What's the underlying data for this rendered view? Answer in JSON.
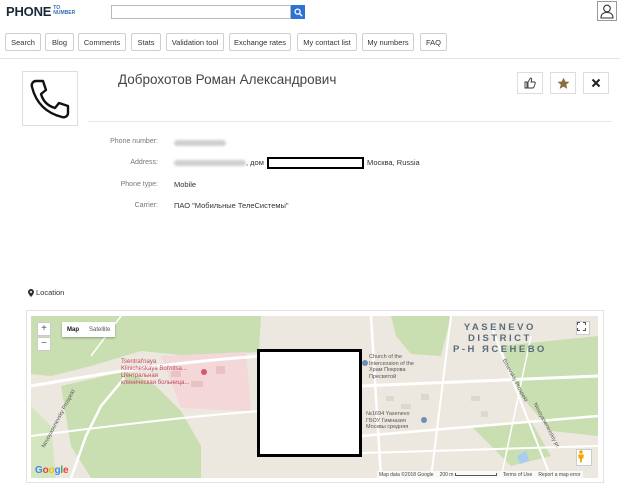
{
  "header": {
    "logo_main": "PHONE",
    "logo_to": "TO",
    "logo_number": "NUMBER",
    "search": {
      "value": "",
      "placeholder": ""
    },
    "icons": {
      "search": "search-icon",
      "user": "user-icon"
    }
  },
  "nav": {
    "items": [
      "Search",
      "Blog",
      "Comments",
      "Stats",
      "Validation tool",
      "Exchange rates",
      "My contact list",
      "My numbers",
      "FAQ"
    ]
  },
  "profile": {
    "name": "Доброхотов Роман Александрович",
    "avatar_icon": "phone-icon",
    "actions": {
      "like_icon": "thumbs-up-icon",
      "favorite_icon": "star-icon",
      "remove_icon": "close-icon"
    }
  },
  "details": {
    "phone_label": "Phone number:",
    "address_label": "Address:",
    "address_visible_part": ", дом",
    "address_city": "Москва, Russia",
    "type_label": "Phone type:",
    "type_value": "Mobile",
    "carrier_label": "Carrier:",
    "carrier_value": "ПАО \"Мобильные ТелеСистемы\""
  },
  "location": {
    "title": "Location",
    "icon": "map-marker-icon",
    "map": {
      "zoom_in": "+",
      "zoom_out": "−",
      "type_map": "Map",
      "type_satellite": "Satellite",
      "district_line1": "YASENEVO",
      "district_line2": "DISTRICT",
      "district_line3": "Р-Н ЯСЕНЕВО",
      "hospital_line1": "Tsentral'naya",
      "hospital_line2": "Klinicheskaya Bol'nitsa...",
      "hospital_line3": "Центральная",
      "hospital_line4": "клиническая больница...",
      "church_line1": "Church of the",
      "church_line2": "Intercession of the",
      "church_line3": "Храм Покрова",
      "church_line4": "Пресвятой",
      "school_line1": "№1694 Yasenevo",
      "school_line2": "ГБОУ Гимназия",
      "school_line3": "Москвы средняя",
      "road_left": "Novoyasenevsky Prospekt",
      "road_right": "Novoyasenevskiy pr.",
      "road_bitsa": "Bitsevskiy Prospekt",
      "google": "Google",
      "attribution": "Map data ©2018 Google",
      "scale": "200 m",
      "terms": "Terms of Use",
      "report": "Report a map error"
    }
  },
  "colors": {
    "accent": "#2f72d6",
    "map_green": "#c8dfb0",
    "map_road": "#ffffff",
    "star": "#8a6d3b"
  }
}
